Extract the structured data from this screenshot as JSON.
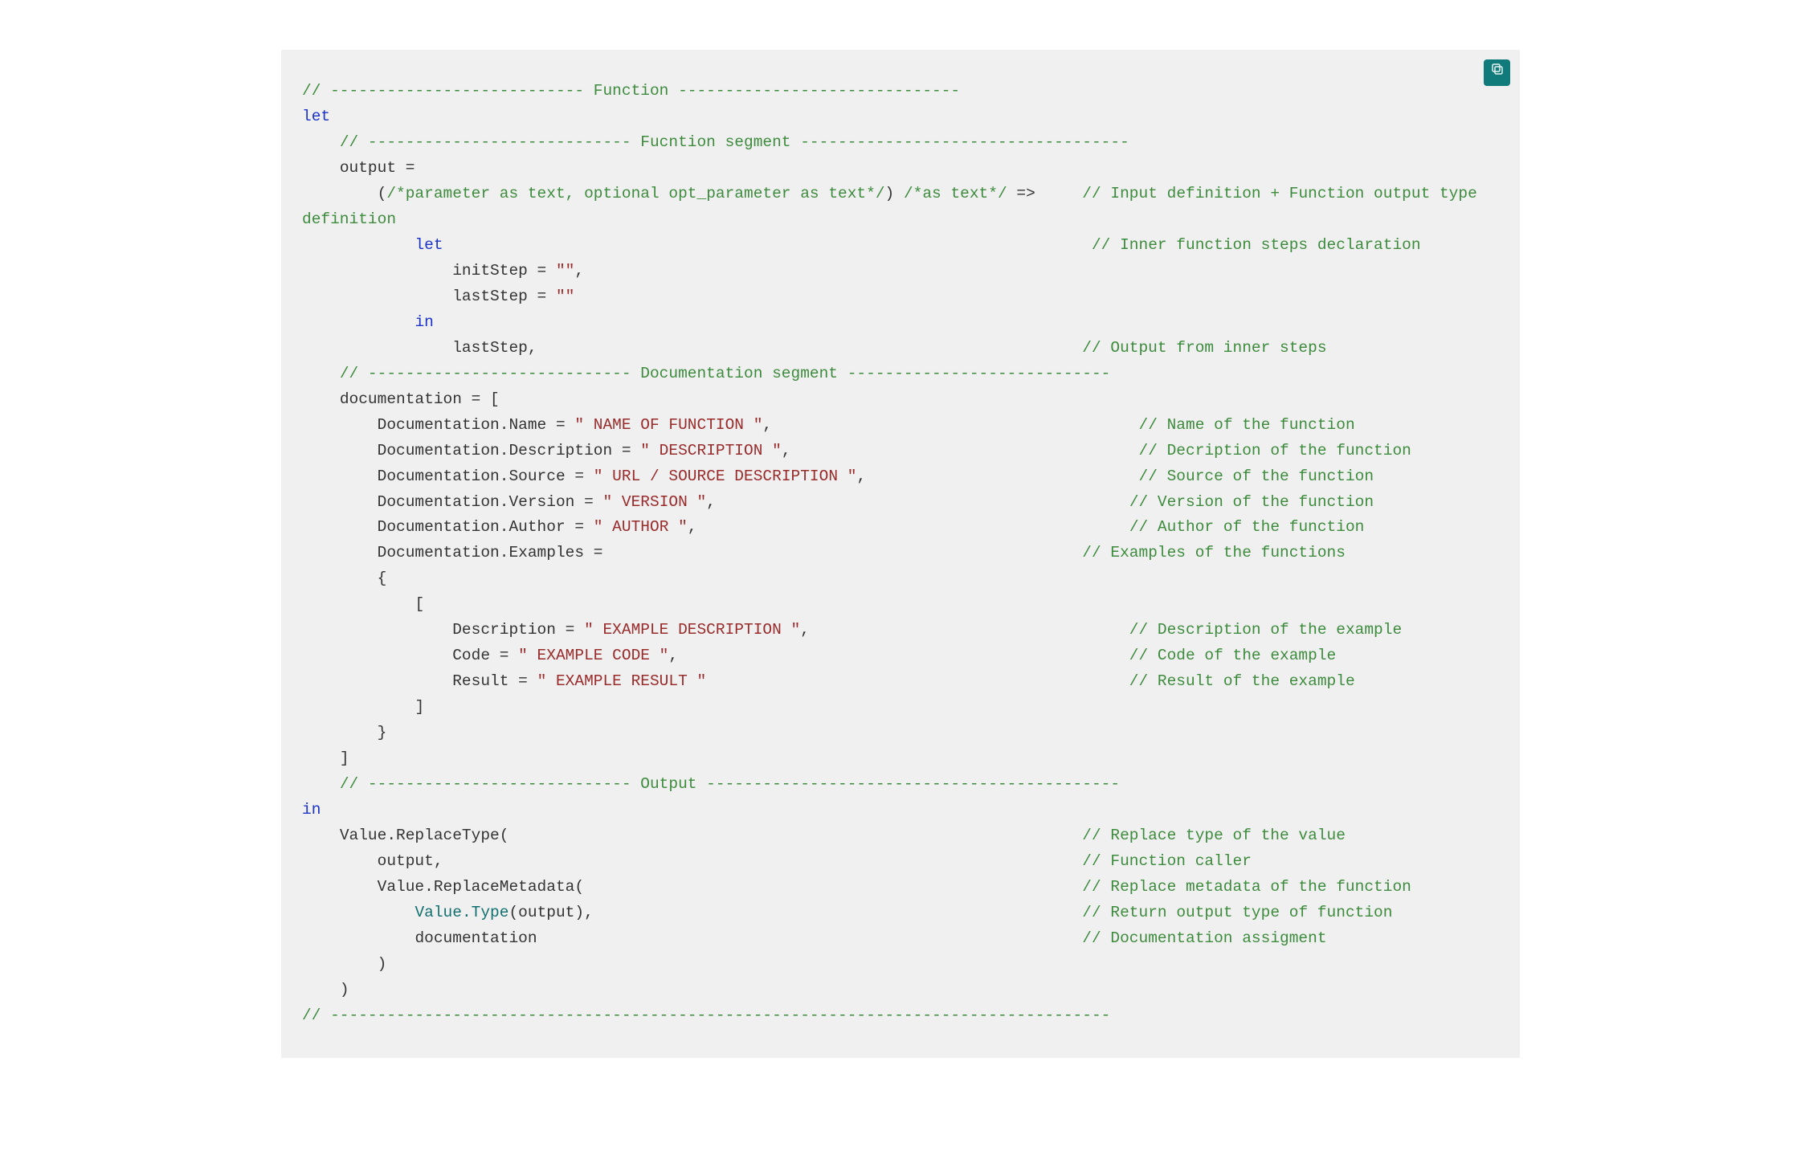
{
  "copy_button": {
    "label": "Copy",
    "icon": "copy-icon"
  },
  "code": {
    "l01_cmt": "// --------------------------- Function ------------------------------",
    "l02_kw": "let",
    "l03_cmt": "    // ---------------------------- Fucntion segment -----------------------------------",
    "l04_txt": "    output =",
    "l05_a": "        (",
    "l05_b": "/*parameter as text, optional opt_parameter as text*/",
    "l05_c": ") ",
    "l05_d": "/*as text*/",
    "l05_e": " =>     ",
    "l05_f": "// Input definition + Function output type definition",
    "l06_a": "            ",
    "l06_b": "let",
    "l06_c": "                                                                     // Inner function steps declaration",
    "l07_txt": "                initStep = ",
    "l07_str": "\"\"",
    "l07_end": ",",
    "l08_txt": "                lastStep = ",
    "l08_str": "\"\"",
    "l09_ind": "            ",
    "l09_kw": "in",
    "l10_txt": "                lastStep,                                                          ",
    "l10_cmt": "// Output from inner steps",
    "l11_cmt": "    // ---------------------------- Documentation segment ----------------------------",
    "l12_txt": "    documentation = [",
    "l13_txt": "        Documentation.Name = ",
    "l13_str": "\" NAME OF FUNCTION \"",
    "l13_end": ",                                       ",
    "l13_cmt": "// Name of the function",
    "l14_txt": "        Documentation.Description = ",
    "l14_str": "\" DESCRIPTION \"",
    "l14_end": ",                                     ",
    "l14_cmt": "// Decription of the function",
    "l15_txt": "        Documentation.Source = ",
    "l15_str": "\" URL / SOURCE DESCRIPTION \"",
    "l15_end": ",                             ",
    "l15_cmt": "// Source of the function",
    "l16_txt": "        Documentation.Version = ",
    "l16_str": "\" VERSION \"",
    "l16_end": ",                                            ",
    "l16_cmt": "// Version of the function",
    "l17_txt": "        Documentation.Author = ",
    "l17_str": "\" AUTHOR \"",
    "l17_end": ",                                              ",
    "l17_cmt": "// Author of the function",
    "l18_txt": "        Documentation.Examples =                                                   ",
    "l18_cmt": "// Examples of the functions",
    "l19_txt": "        {",
    "l20_txt": "            [",
    "l21_txt": "                Description = ",
    "l21_str": "\" EXAMPLE DESCRIPTION \"",
    "l21_end": ",                                  ",
    "l21_cmt": "// Description of the example",
    "l22_txt": "                Code = ",
    "l22_str": "\" EXAMPLE CODE \"",
    "l22_end": ",                                                ",
    "l22_cmt": "// Code of the example",
    "l23_txt": "                Result = ",
    "l23_str": "\" EXAMPLE RESULT \"",
    "l23_end": "                                             ",
    "l23_cmt": "// Result of the example",
    "l24_txt": "            ]",
    "l25_txt": "        }",
    "l26_txt": "    ]",
    "l27_cmt": "    // ---------------------------- Output --------------------------------------------",
    "l28_kw": "in",
    "l29_txt": "    Value.ReplaceType(                                                             ",
    "l29_cmt": "// Replace type of the value",
    "l30_txt": "        output,                                                                    ",
    "l30_cmt": "// Function caller",
    "l31_txt": "        Value.ReplaceMetadata(                                                     ",
    "l31_cmt": "// Replace metadata of the function",
    "l32_ind": "            ",
    "l32_fn": "Value.Type",
    "l32_txt": "(output),                                                    ",
    "l32_cmt": "// Return output type of function",
    "l33_txt": "            documentation                                                          ",
    "l33_cmt": "// Documentation assigment",
    "l34_txt": "        )",
    "l35_txt": "    )",
    "l36_cmt": "// -----------------------------------------------------------------------------------"
  }
}
